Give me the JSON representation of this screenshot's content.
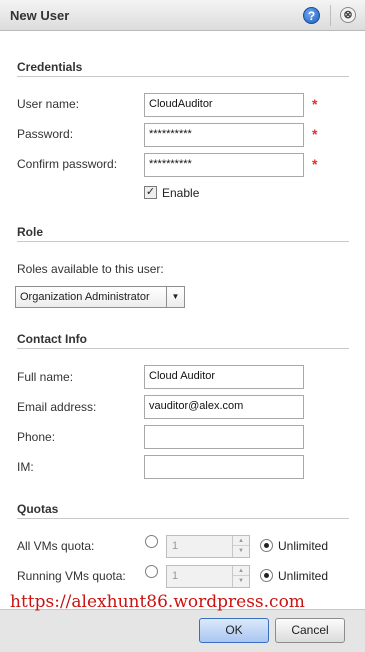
{
  "dialog": {
    "title": "New User",
    "help_icon": "?",
    "close_icon": "⊗"
  },
  "credentials": {
    "heading": "Credentials",
    "username_label": "User name:",
    "username_value": "CloudAuditor",
    "password_label": "Password:",
    "password_value": "**********",
    "confirm_label": "Confirm password:",
    "confirm_value": "**********",
    "required_mark": "*",
    "enable_label": "Enable",
    "enable_checked": true
  },
  "role": {
    "heading": "Role",
    "roles_label": "Roles available to this user:",
    "selected_role": "Organization Administrator"
  },
  "contact": {
    "heading": "Contact Info",
    "fullname_label": "Full name:",
    "fullname_value": "Cloud Auditor",
    "email_label": "Email address:",
    "email_value": "vauditor@alex.com",
    "phone_label": "Phone:",
    "phone_value": "",
    "im_label": "IM:",
    "im_value": ""
  },
  "quotas": {
    "heading": "Quotas",
    "all_vms_label": "All VMs quota:",
    "all_vms_value": "1",
    "running_vms_label": "Running VMs quota:",
    "running_vms_value": "1",
    "unlimited_label": "Unlimited"
  },
  "watermark": "https://alexhunt86.wordpress.com",
  "footer": {
    "ok_label": "OK",
    "cancel_label": "Cancel"
  },
  "colors": {
    "required": "#dd3333",
    "watermark": "#cc1111",
    "ok_accent": "#3a6fc0"
  }
}
